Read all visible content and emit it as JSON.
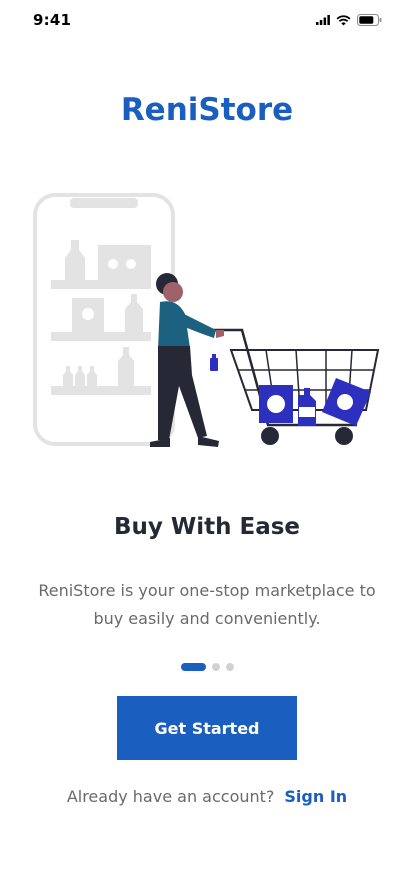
{
  "status_bar": {
    "time": "9:41",
    "icons": [
      "signal-icon",
      "wifi-icon",
      "battery-icon"
    ]
  },
  "brand": {
    "name": "ReniStore",
    "color": "#1a5fbf"
  },
  "illustration": {
    "subject": "shopping-cart-illustration"
  },
  "onboarding": {
    "headline": "Buy With Ease",
    "description": "ReniStore is your one-stop marketplace to buy easily and conveniently.",
    "page_indicator": {
      "current": 1,
      "total": 3
    }
  },
  "actions": {
    "get_started_label": "Get Started",
    "signin_prompt": "Already have an account?",
    "signin_link": "Sign In"
  },
  "colors": {
    "accent": "#1a5fbf",
    "text_dark": "#262836",
    "text_muted": "#6a6a6a",
    "illustration_blue": "#2d2fbf"
  }
}
